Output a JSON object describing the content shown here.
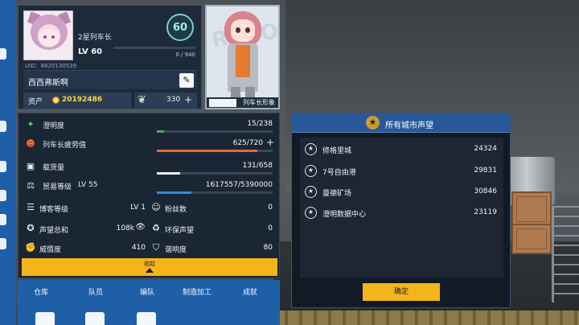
{
  "profile": {
    "rank_title": "2星列车长",
    "level_badge": "60",
    "level_text": "LV 60",
    "xp_text": "0 / 940",
    "xp_progress": 0,
    "uid": "UID：8820130539",
    "player_name": "西西弗斯啊",
    "assets_label": "资产",
    "assets_value": "20192486",
    "feather_value": "330",
    "plus": "+"
  },
  "portrait": {
    "label": "列车长形象",
    "bg_text": "ROCOM"
  },
  "stats": {
    "clarity": {
      "label": "澄明度",
      "value": "15/238",
      "progress": 0.063,
      "color": "#4caf50"
    },
    "fatigue": {
      "label": "列车长疲劳值",
      "value": "625/720",
      "progress": 0.868,
      "color": "#e06a3a"
    },
    "cargo": {
      "label": "载货量",
      "value": "131/658",
      "progress": 0.199,
      "color": "#e8eef5"
    },
    "trade": {
      "label": "贸易等级",
      "level": "LV 55",
      "value": "1617557/5390000",
      "progress": 0.3,
      "color": "#2f8be0"
    },
    "blogger": {
      "label": "博客等级",
      "value": "LV 1"
    },
    "fans": {
      "label": "粉丝数",
      "value": "0"
    },
    "reputation_total": {
      "label": "声望总和",
      "value": "108k"
    },
    "eco": {
      "label": "环保声望",
      "value": "0"
    },
    "deterrence": {
      "label": "威慑度",
      "value": "410"
    },
    "resonance": {
      "label": "谐响度",
      "value": "80"
    },
    "collapse_label": "收起"
  },
  "bottom_nav": [
    "仓库",
    "队员",
    "编队",
    "制造加工",
    "成就"
  ],
  "dialog": {
    "title": "所有城市声望",
    "cities": [
      {
        "name": "修格里城",
        "value": "24324"
      },
      {
        "name": "7号自由港",
        "value": "29831"
      },
      {
        "name": "曼德矿场",
        "value": "30846"
      },
      {
        "name": "澄明数据中心",
        "value": "23119"
      }
    ],
    "confirm": "确定"
  },
  "colors": {
    "accent_yellow": "#f3b51b",
    "panel_dark": "#1b2635",
    "nav_blue": "#1f5fa8"
  }
}
